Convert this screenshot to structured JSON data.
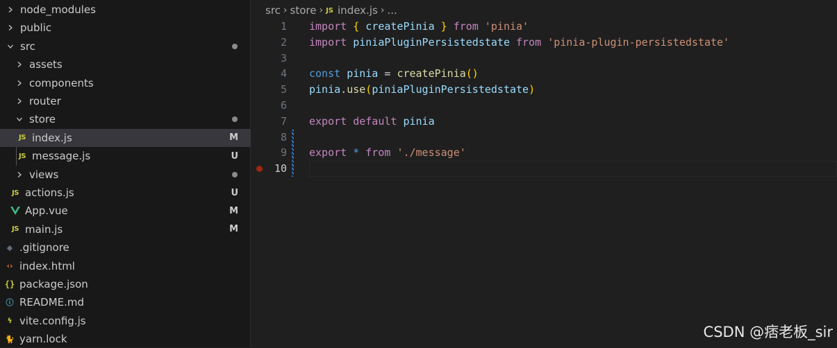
{
  "explorer": {
    "items": [
      {
        "label": "node_modules",
        "kind": "folder",
        "open": false,
        "icon": "chevron-right-icon"
      },
      {
        "label": "public",
        "kind": "folder",
        "open": false,
        "icon": "chevron-right-icon"
      },
      {
        "label": "src",
        "kind": "folder",
        "open": true,
        "icon": "chevron-down-icon",
        "status": "dot"
      },
      {
        "label": "assets",
        "kind": "folder",
        "open": false,
        "icon": "chevron-right-icon"
      },
      {
        "label": "components",
        "kind": "folder",
        "open": false,
        "icon": "chevron-right-icon"
      },
      {
        "label": "router",
        "kind": "folder",
        "open": false,
        "icon": "chevron-right-icon"
      },
      {
        "label": "store",
        "kind": "folder",
        "open": true,
        "icon": "chevron-down-icon",
        "status": "dot"
      },
      {
        "label": "index.js",
        "kind": "file",
        "icon": "js-icon",
        "icon_text": "JS",
        "status": "M",
        "selected": true
      },
      {
        "label": "message.js",
        "kind": "file",
        "icon": "js-icon",
        "icon_text": "JS",
        "status": "U"
      },
      {
        "label": "views",
        "kind": "folder",
        "open": false,
        "icon": "chevron-right-icon",
        "status": "dot"
      },
      {
        "label": "actions.js",
        "kind": "file",
        "icon": "js-icon",
        "icon_text": "JS",
        "status": "U"
      },
      {
        "label": "App.vue",
        "kind": "file",
        "icon": "vue-icon",
        "status": "M"
      },
      {
        "label": "main.js",
        "kind": "file",
        "icon": "js-icon",
        "icon_text": "JS",
        "status": "M"
      },
      {
        "label": ".gitignore",
        "kind": "file",
        "icon": "git-icon"
      },
      {
        "label": "index.html",
        "kind": "file",
        "icon": "html-icon"
      },
      {
        "label": "package.json",
        "kind": "file",
        "icon": "json-icon",
        "icon_text": "{}"
      },
      {
        "label": "README.md",
        "kind": "file",
        "icon": "info-icon"
      },
      {
        "label": "vite.config.js",
        "kind": "file",
        "icon": "vite-icon"
      },
      {
        "label": "yarn.lock",
        "kind": "file",
        "icon": "yarn-icon"
      }
    ]
  },
  "breadcrumb": {
    "parts": [
      "src",
      "store",
      "index.js",
      "..."
    ],
    "file_icon_text": "JS"
  },
  "editor": {
    "lines": [
      {
        "n": "1",
        "tokens": [
          [
            "k",
            "import"
          ],
          [
            "p",
            " "
          ],
          [
            "br",
            "{"
          ],
          [
            "p",
            " "
          ],
          [
            "v",
            "createPinia"
          ],
          [
            "p",
            " "
          ],
          [
            "br",
            "}"
          ],
          [
            "p",
            " "
          ],
          [
            "k",
            "from"
          ],
          [
            "p",
            " "
          ],
          [
            "s",
            "'pinia'"
          ]
        ]
      },
      {
        "n": "2",
        "tokens": [
          [
            "k",
            "import"
          ],
          [
            "p",
            " "
          ],
          [
            "v",
            "piniaPluginPersistedstate"
          ],
          [
            "p",
            " "
          ],
          [
            "k",
            "from"
          ],
          [
            "p",
            " "
          ],
          [
            "s",
            "'pinia-plugin-persistedstate'"
          ]
        ]
      },
      {
        "n": "3",
        "tokens": []
      },
      {
        "n": "4",
        "tokens": [
          [
            "kb",
            "const"
          ],
          [
            "p",
            " "
          ],
          [
            "v",
            "pinia"
          ],
          [
            "p",
            " = "
          ],
          [
            "f",
            "createPinia"
          ],
          [
            "br",
            "()"
          ]
        ]
      },
      {
        "n": "5",
        "tokens": [
          [
            "v",
            "pinia"
          ],
          [
            "p",
            "."
          ],
          [
            "f",
            "use"
          ],
          [
            "br",
            "("
          ],
          [
            "v",
            "piniaPluginPersistedstate"
          ],
          [
            "br",
            ")"
          ]
        ]
      },
      {
        "n": "6",
        "tokens": []
      },
      {
        "n": "7",
        "tokens": [
          [
            "k",
            "export"
          ],
          [
            "p",
            " "
          ],
          [
            "k",
            "default"
          ],
          [
            "p",
            " "
          ],
          [
            "v",
            "pinia"
          ]
        ]
      },
      {
        "n": "8",
        "tokens": []
      },
      {
        "n": "9",
        "tokens": [
          [
            "k",
            "export"
          ],
          [
            "p",
            " "
          ],
          [
            "kb",
            "*"
          ],
          [
            "p",
            " "
          ],
          [
            "k",
            "from"
          ],
          [
            "p",
            " "
          ],
          [
            "s",
            "'./message'"
          ]
        ]
      },
      {
        "n": "10",
        "tokens": [],
        "current": true,
        "breakpoint": true
      }
    ]
  },
  "watermark": "CSDN @痞老板_sir"
}
